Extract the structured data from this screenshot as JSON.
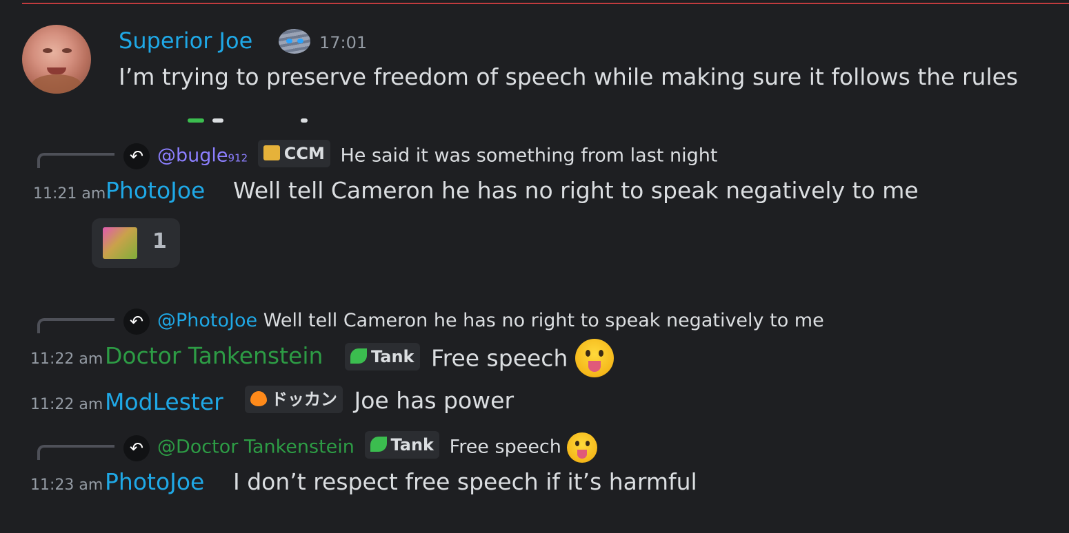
{
  "messages": {
    "top": {
      "author": "Superior Joe",
      "time": "17:01",
      "text": "I’m trying to preserve freedom of speech while making sure it follows the rules"
    },
    "m1": {
      "reply": {
        "mention": "@bugle",
        "mention_sub": "912",
        "tag": "CCM",
        "text": "He said it was something from last night"
      },
      "time": "11:21 am",
      "author": "PhotoJoe",
      "text": "Well tell Cameron he has no right to speak negatively to me",
      "reaction": {
        "count": "1"
      }
    },
    "m2": {
      "reply": {
        "mention": "@PhotoJoe",
        "text": "Well tell Cameron he has no right to speak negatively to me"
      },
      "time": "11:22 am",
      "author": "Doctor Tankenstein",
      "tag": "Tank",
      "text": "Free speech"
    },
    "m3": {
      "time": "11:22 am",
      "author": "ModLester",
      "tag": "ドッカン",
      "text": "Joe has power"
    },
    "m4": {
      "reply": {
        "mention": "@Doctor Tankenstein",
        "tag": "Tank",
        "text": "Free speech"
      },
      "time": "11:23 am",
      "author": "PhotoJoe",
      "text": "I don’t respect free speech if it’s harmful"
    }
  },
  "colors": {
    "background": "#1e1f22",
    "blue_name": "#1fa8e6",
    "green_name": "#2d9c45",
    "purple_mention": "#8c7fff",
    "divider_red": "#c13b3e"
  },
  "icons": [
    "reply-arrow-icon",
    "mummy-emoji-icon",
    "crown-icon",
    "leaf-icon",
    "flame-icon",
    "tongue-out-emoji-icon",
    "face-reaction-icon"
  ]
}
